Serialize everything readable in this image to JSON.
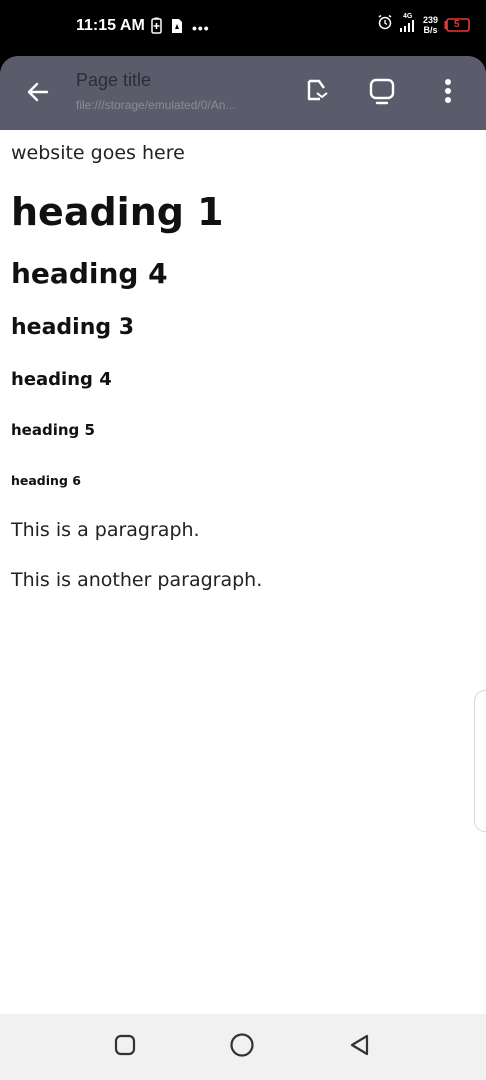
{
  "status_bar": {
    "time": "11:15 AM",
    "more_indicator": "•••",
    "network_type": "4G",
    "net_speed_value": "239",
    "net_speed_unit": "B/s",
    "battery_level": "5"
  },
  "toolbar": {
    "title": "Page title",
    "url": "file:///storage/emulated/0/An..."
  },
  "content": {
    "intro": "website goes here",
    "heading1": "heading 1",
    "heading2": "heading 4",
    "heading3": "heading 3",
    "heading4": "heading 4",
    "heading5": "heading 5",
    "heading6": "heading 6",
    "paragraph1": "This is a paragraph.",
    "paragraph2": "This is another paragraph."
  },
  "icons": {
    "back": "arrow-left-icon",
    "open_external": "open-in-icon",
    "desktop_mode": "tablet-icon",
    "more": "more-vert-icon",
    "nav_recents": "square-icon",
    "nav_home": "circle-icon",
    "nav_back": "triangle-back-icon"
  },
  "colors": {
    "toolbar_bg": "#5a5c6b",
    "status_bg": "#000000",
    "battery_low": "#e53935"
  }
}
